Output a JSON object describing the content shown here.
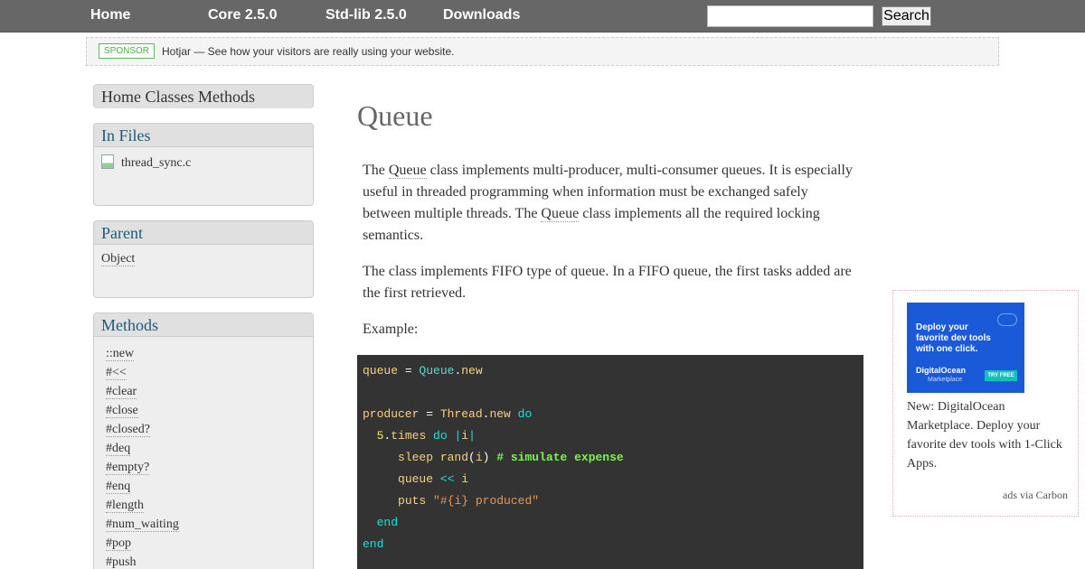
{
  "nav": {
    "items": [
      "Home",
      "Core 2.5.0",
      "Std-lib 2.5.0",
      "Downloads"
    ],
    "search_value": "",
    "search_button": "Search"
  },
  "sponsor": {
    "badge": "SPONSOR",
    "text": "Hotjar — See how your visitors are really using your website."
  },
  "sidebar": {
    "breadcrumb": "Home Classes Methods",
    "in_files": {
      "title": "In Files",
      "files": [
        "thread_sync.c"
      ]
    },
    "parent": {
      "title": "Parent",
      "value": "Object"
    },
    "methods": {
      "title": "Methods",
      "items": [
        "::new",
        "#<<",
        "#clear",
        "#close",
        "#closed?",
        "#deq",
        "#empty?",
        "#enq",
        "#length",
        "#num_waiting",
        "#pop",
        "#push"
      ]
    }
  },
  "main": {
    "title": "Queue",
    "para1": {
      "before": "The ",
      "code1": "Queue",
      "middle": " class implements multi-producer, multi-consumer queues. It is especially useful in threaded programming when information must be exchanged safely between multiple threads. The ",
      "code2": "Queue",
      "after": " class implements all the required locking semantics."
    },
    "para2": "The class implements FIFO type of queue. In a FIFO queue, the first tasks added are the first retrieved.",
    "para3": "Example:",
    "code": {
      "l1": {
        "a": "queue",
        "b": " = ",
        "c": "Queue",
        "d": ".",
        "e": "new"
      },
      "l3": {
        "a": "producer",
        "b": " = ",
        "c": "Thread",
        "d": ".",
        "e": "new",
        "f": " do"
      },
      "l4": {
        "a": "5",
        "b": ".",
        "c": "times",
        "d": " do ",
        "e": "|",
        "f": "i",
        "g": "|"
      },
      "l5": {
        "a": "sleep",
        "b": " rand",
        "c": "(",
        "d": "i",
        "e": ") ",
        "f": "# simulate expense"
      },
      "l6": {
        "a": "queue",
        "b": " << ",
        "c": "i"
      },
      "l7": {
        "a": "puts",
        "b": " \"#{i} produced\""
      },
      "l8": "end",
      "l9": "end"
    }
  },
  "ad": {
    "image_headline": "Deploy your favorite dev tools with one click.",
    "image_logo": "DigitalOcean",
    "image_logo_sub": "Marketplace",
    "image_cta": "TRY FREE",
    "text": "New: DigitalOcean Marketplace. Deploy your favorite dev tools with 1-Click Apps.",
    "via": "ads via Carbon"
  }
}
